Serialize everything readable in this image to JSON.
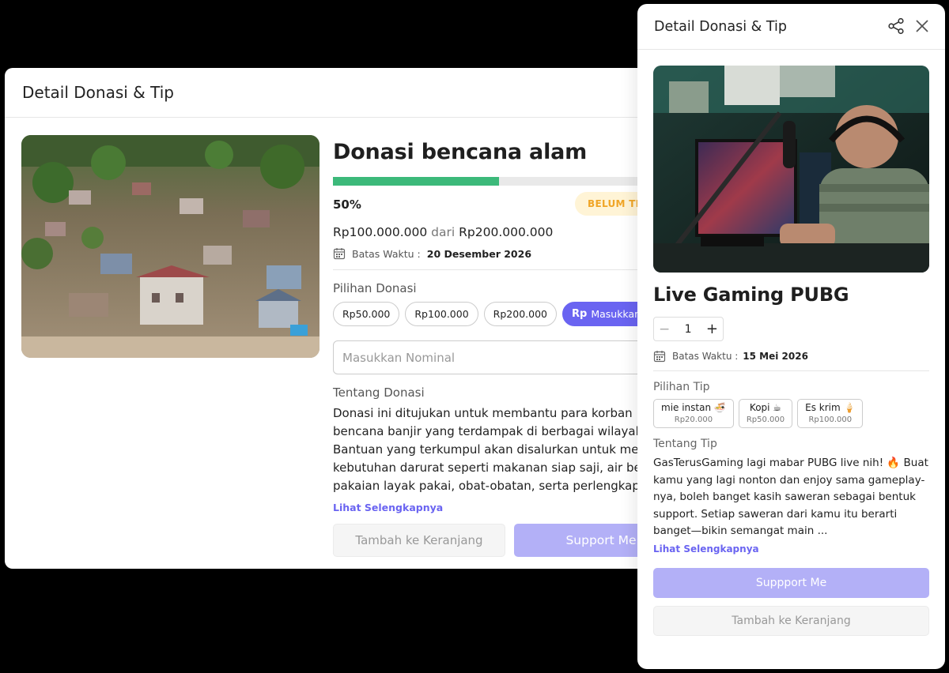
{
  "left_modal": {
    "header_title": "Detail Donasi & Tip",
    "image_alt": "Aerial view of flood disaster area",
    "campaign_title": "Donasi bencana alam",
    "progress_fraction": 0.5,
    "progress_percent_label": "50%",
    "status_badge": "BELUM TERCAPAI",
    "amount_collected": "Rp100.000.000",
    "amount_separator": "dari",
    "amount_target": "Rp200.000.000",
    "deadline_label": "Batas Waktu :",
    "deadline_value": "20 Desember 2026",
    "options_label": "Pilihan Donasi",
    "options": [
      "Rp50.000",
      "Rp100.000",
      "Rp200.000"
    ],
    "custom_option_prefix": "Rp",
    "custom_option_label": "Masukkan Nominal",
    "nominal_placeholder": "Masukkan Nominal",
    "about_label": "Tentang Donasi",
    "description_lines": [
      "Donasi ini ditujukan untuk membantu para korban",
      "bencana banjir yang terdampak di berbagai wilayah.",
      "Bantuan yang terkumpul akan disalurkan untuk memenuhi",
      "kebutuhan darurat seperti makanan siap saji, air bersih,",
      "pakaian layak pakai, obat-obatan, serta perlengkapan"
    ],
    "see_more": "Lihat Selengkapnya",
    "cart_button": "Tambah ke Keranjang",
    "support_button": "Support Me"
  },
  "right_panel": {
    "header_title": "Detail Donasi & Tip",
    "share_icon": "share-icon",
    "close_icon": "close-icon",
    "image_alt": "Gamer streaming at desk with microphone",
    "item_title": "Live Gaming PUBG",
    "quantity": "1",
    "deadline_label": "Batas Waktu :",
    "deadline_value": "15 Mei 2026",
    "tips_label": "Pilihan Tip",
    "tips": [
      {
        "name": "mie instan 🍜",
        "price": "Rp20.000"
      },
      {
        "name": "Kopi ☕",
        "price": "Rp50.000"
      },
      {
        "name": "Es krim 🍦",
        "price": "Rp100.000"
      }
    ],
    "about_label": "Tentang Tip",
    "description": "GasTerusGaming lagi mabar PUBG live nih! 🔥  Buat kamu yang lagi nonton dan enjoy sama gameplay-nya, boleh banget kasih saweran sebagai bentuk support. Setiap saweran dari kamu itu berarti banget—bikin semangat main ...",
    "see_more": "Lihat Selengkapnya",
    "support_button": "Suppport Me",
    "cart_button": "Tambah ke Keranjang"
  },
  "colors": {
    "accent": "#6a64f1",
    "accent_light": "#b3b0f7",
    "progress": "#3cb97a",
    "badge_bg": "#fff4d6",
    "badge_text": "#f0a526"
  }
}
